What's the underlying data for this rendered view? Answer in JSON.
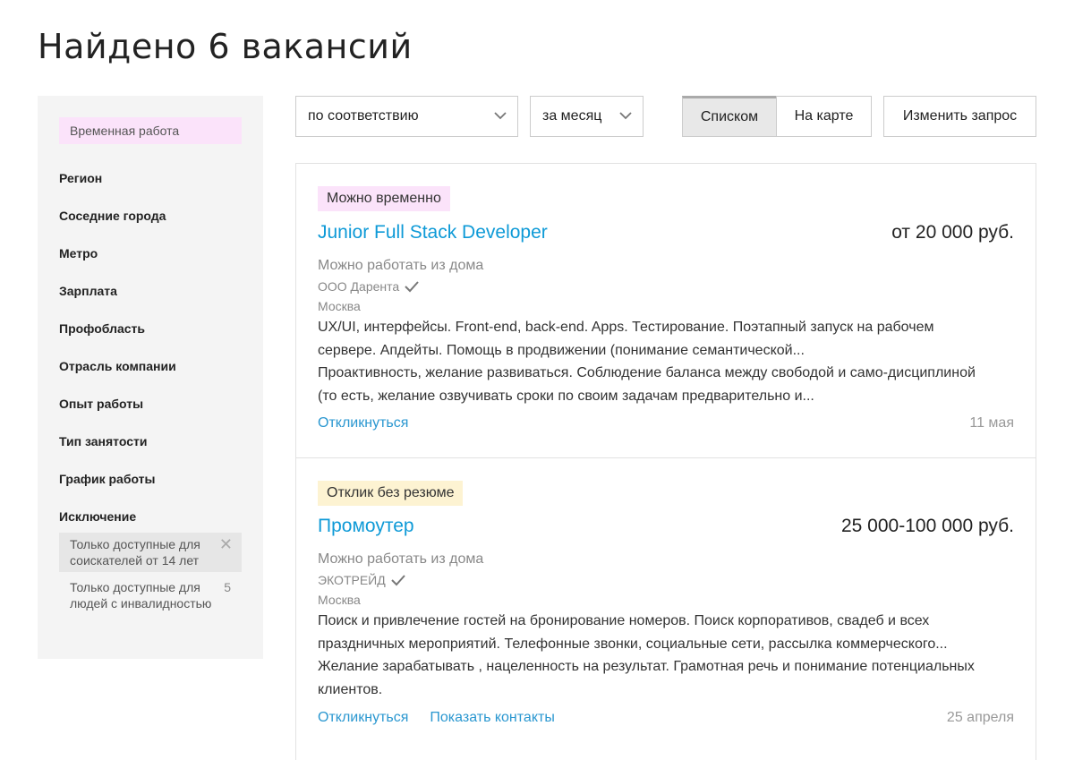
{
  "page": {
    "title": "Найдено 6 вакансий"
  },
  "sidebar": {
    "active_chip": "Временная работа",
    "filters": [
      "Регион",
      "Соседние города",
      "Метро",
      "Зарплата",
      "Профобласть",
      "Отрасль компании",
      "Опыт работы",
      "Тип занятости",
      "График работы",
      "Исключение"
    ],
    "exclusions": [
      {
        "label": "Только доступные для соискателей от 14 лет",
        "active": true
      },
      {
        "label": "Только доступные для людей с инвалидностью",
        "count": "5"
      }
    ]
  },
  "controls": {
    "sort": "по соответствию",
    "period": "за месяц",
    "view_list": "Списком",
    "view_map": "На карте",
    "change_query": "Изменить запрос"
  },
  "vacancies": [
    {
      "badge": "Можно временно",
      "badge_color": "#fbe3fa",
      "title": "Junior Full Stack Developer",
      "salary": "от 20 000 руб.",
      "remote": "Можно работать из дома",
      "company": "ООО Дарента",
      "city": "Москва",
      "desc1": "UX/UI, интерфейсы. Front-end, back-end. Apps. Тестирование. Поэтапный запуск на рабочем сервере. Апдейты. Помощь в продвижении (понимание семантической...",
      "desc2": "Проактивность, желание развиваться. Соблюдение баланса между свободой и само-дисциплиной (то есть, желание озвучивать сроки по своим задачам предварительно и...",
      "apply": "Откликнуться",
      "date": "11 мая"
    },
    {
      "badge": "Отклик без резюме",
      "badge_color": "#fdf3d2",
      "title": "Промоутер",
      "salary": "25 000-100 000 руб.",
      "remote": "Можно работать из дома",
      "company": "ЭКОТРЕЙД",
      "city": "Москва",
      "desc1": "Поиск и привлечение гостей на бронирование номеров. Поиск корпоративов, свадеб и всех праздничных мероприятий. Телефонные звонки, социальные сети, рассылка коммерческого...",
      "desc2": "Желание зарабатывать , нацеленность на результат. Грамотная речь и понимание потенциальных клиентов.",
      "apply": "Откликнуться",
      "contacts": "Показать контакты",
      "date": "25 апреля"
    }
  ]
}
